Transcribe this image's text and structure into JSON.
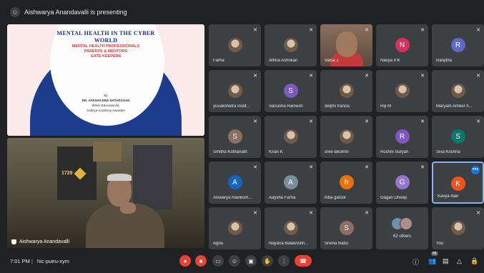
{
  "top": {
    "presenting_text": "Aishwarya Anandavalli is presenting"
  },
  "slide": {
    "title_line1": "MENTAL HEALTH IN THE CYBER",
    "title_line2": "WORLD",
    "subtitle_lines": [
      "MENTAL HEALTH PROFESSIONALS",
      "PARENTS & MENTORS",
      "GATE KEEPERS"
    ],
    "by": "By",
    "author": "DR. AYESHA ERA NATARASAN",
    "role": "Writer Educationist,",
    "award": "Sahitya Academy Awardee"
  },
  "presenter": {
    "name": "Aishwarya Anandavalli",
    "poster_text": "1729"
  },
  "participants": [
    {
      "name": "Farha",
      "initial": "",
      "color": "#ffffff",
      "photo": true
    },
    {
      "name": "Athira Ashokan",
      "initial": "",
      "color": "#ffffff",
      "photo": true
    },
    {
      "name": "Valsa J",
      "initial": "",
      "color": "",
      "photo": false
    },
    {
      "name": "Navya P.K",
      "initial": "N",
      "color": "#d93062"
    },
    {
      "name": "Ranjitha",
      "initial": "R",
      "color": "#5c6bc0"
    },
    {
      "name": "yuvakshetra Instit...",
      "initial": "",
      "color": "#ffffff",
      "photo": true
    },
    {
      "name": "Sanusha Ramesh",
      "initial": "S",
      "color": "#7e57c2"
    },
    {
      "name": "delphi francis",
      "initial": "",
      "color": "#ffffff",
      "photo": true
    },
    {
      "name": "Riji M",
      "initial": "",
      "color": "#ffffff",
      "photo": true
    },
    {
      "name": "Maryam Ameer h...",
      "initial": "",
      "color": "#ffffff",
      "photo": true
    },
    {
      "name": "Smitha Kothanath",
      "initial": "S",
      "color": "#8d6e63"
    },
    {
      "name": "Kiran K",
      "initial": "",
      "color": "#ffffff",
      "photo": true
    },
    {
      "name": "sree lakshmi",
      "initial": "",
      "color": "#ffffff",
      "photo": true
    },
    {
      "name": "Roshni Suryan",
      "initial": "R",
      "color": "#7e57c2"
    },
    {
      "name": "Siva Krishna",
      "initial": "S",
      "color": "#00796b"
    },
    {
      "name": "Aiswarya Ravikum...",
      "initial": "A",
      "color": "#1565c0"
    },
    {
      "name": "Aaysha Farha",
      "initial": "A",
      "color": "#78909c"
    },
    {
      "name": "hiba gafoor",
      "initial": "h",
      "color": "#e8710a"
    },
    {
      "name": "Gagan Dheep",
      "initial": "G",
      "color": "#9575cd"
    },
    {
      "name": "Kavya Nair",
      "initial": "K",
      "color": "#f4511e"
    },
    {
      "name": "Agna",
      "initial": "",
      "color": "#ffffff",
      "photo": true
    },
    {
      "name": "Nayana Balakrishn...",
      "initial": "",
      "color": "#ffffff",
      "photo": true
    },
    {
      "name": "Sneha Babu",
      "initial": "S",
      "color": "#8d6e63"
    },
    {
      "name": "",
      "initial": "",
      "color": "",
      "others": true
    },
    {
      "name": "You",
      "initial": "",
      "color": "#ffffff",
      "photo": true
    }
  ],
  "others_label": "62 others",
  "bottom": {
    "time": "7:01 PM",
    "separator": "|",
    "meeting_code": "hic-pueu-xym",
    "participant_count_badge": "88"
  },
  "colors": {
    "background": "#202124",
    "tile": "#3c4043",
    "end_call": "#ea4335",
    "accent": "#1a73e8"
  },
  "icons": [
    "microphone-off-icon",
    "camera-off-icon",
    "captions-icon",
    "emoji-icon",
    "present-icon",
    "raise-hand-icon",
    "more-options-icon",
    "end-call-icon",
    "info-icon",
    "people-icon",
    "chat-icon",
    "activities-icon",
    "host-controls-icon"
  ]
}
